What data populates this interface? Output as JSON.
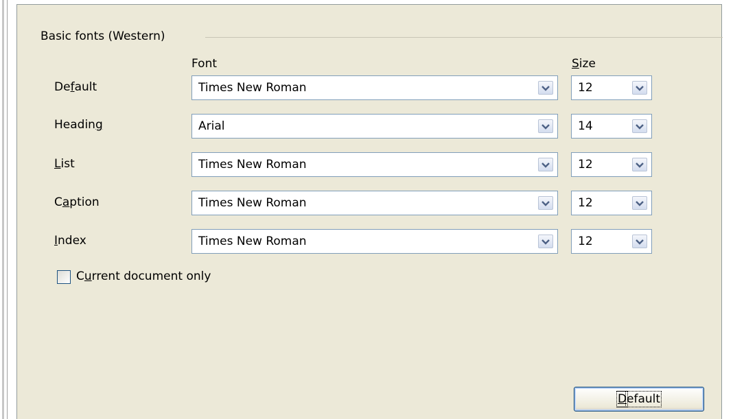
{
  "section": {
    "title": "Basic fonts (Western)"
  },
  "columns": {
    "font": "Font",
    "size_rest": "ize",
    "size_mnemonic": "S"
  },
  "rows": [
    {
      "label_pre": "De",
      "label_mn": "f",
      "label_post": "ault",
      "font": "Times New Roman",
      "size": "12"
    },
    {
      "label_pre": "Headin",
      "label_mn": "g",
      "label_post": "",
      "font": "Arial",
      "size": "14"
    },
    {
      "label_pre": "",
      "label_mn": "L",
      "label_post": "ist",
      "font": "Times New Roman",
      "size": "12"
    },
    {
      "label_pre": "C",
      "label_mn": "a",
      "label_post": "ption",
      "font": "Times New Roman",
      "size": "12"
    },
    {
      "label_pre": "",
      "label_mn": "I",
      "label_post": "ndex",
      "font": "Times New Roman",
      "size": "12"
    }
  ],
  "checkbox": {
    "label_pre": "C",
    "label_mn": "u",
    "label_post": "rrent document only",
    "checked": false
  },
  "button": {
    "mnemonic": "D",
    "label_rest": "efault"
  },
  "icons": {
    "dropdown": "chevron-down-icon"
  }
}
